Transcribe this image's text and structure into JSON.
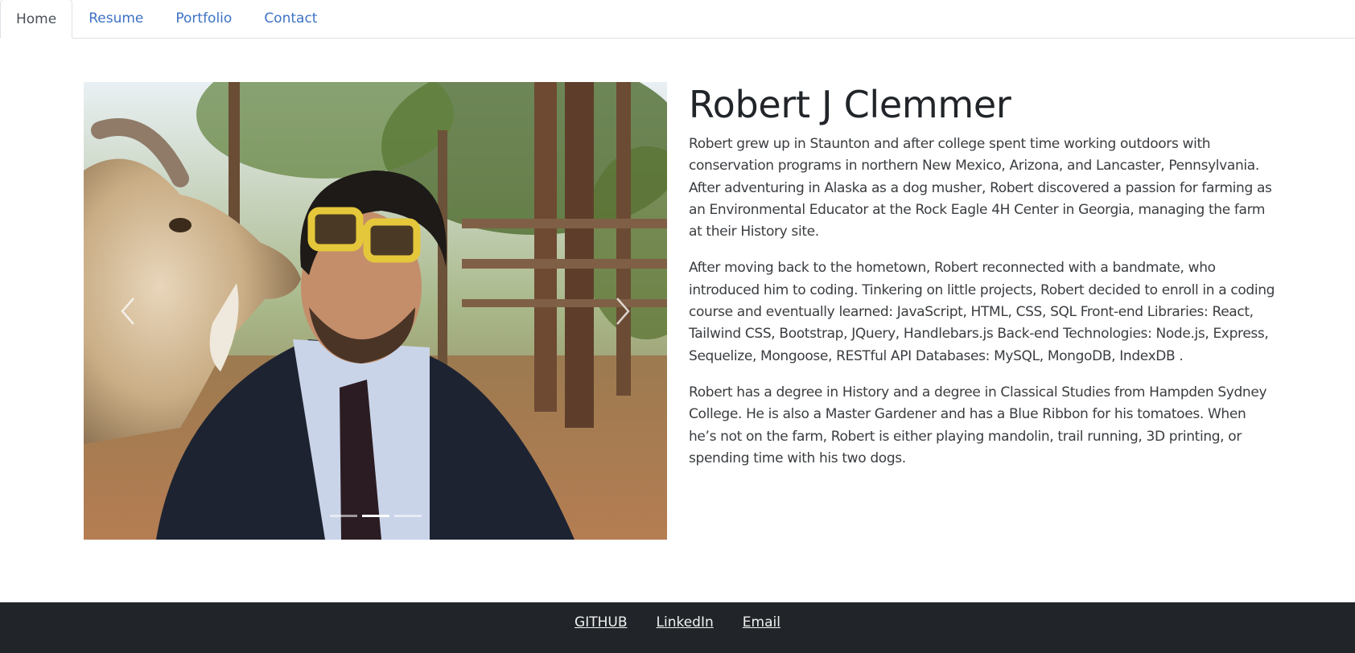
{
  "nav": {
    "tabs": [
      {
        "label": "Home",
        "active": true
      },
      {
        "label": "Resume",
        "active": false
      },
      {
        "label": "Portfolio",
        "active": false
      },
      {
        "label": "Contact",
        "active": false
      }
    ]
  },
  "carousel": {
    "prev_icon": "chevron-left-icon",
    "next_icon": "chevron-right-icon",
    "slide_count": 3,
    "active_index": 1
  },
  "bio": {
    "name": "Robert J Clemmer",
    "paragraphs": [
      "Robert grew up in Staunton and after college spent time working outdoors with conservation programs in northern New Mexico, Arizona, and Lancaster, Pennsylvania. After adventuring in Alaska as a dog musher, Robert discovered a passion for farming as an Environmental Educator at the Rock Eagle 4H Center in Georgia, managing the farm at their History site.",
      "After moving back to the hometown, Robert reconnected with a bandmate, who introduced him to coding. Tinkering on little projects, Robert decided to enroll in a coding course and eventually learned: JavaScript, HTML, CSS, SQL Front-end Libraries: React, Tailwind CSS, Bootstrap, JQuery, Handlebars.js Back-end Technologies: Node.js, Express, Sequelize, Mongoose, RESTful API Databases: MySQL, MongoDB, IndexDB .",
      "Robert has a degree in History and a degree in Classical Studies from Hampden Sydney College. He is also a Master Gardener and has a Blue Ribbon for his tomatoes. When he’s not on the farm, Robert is either playing mandolin, trail running, 3D printing, or spending time with his two dogs."
    ]
  },
  "footer": {
    "links": [
      "GITHUB",
      "LinkedIn",
      "Email"
    ]
  },
  "colors": {
    "link": "#3d72c4",
    "footer_bg": "#212529",
    "footer_text": "#f1f1f1"
  }
}
